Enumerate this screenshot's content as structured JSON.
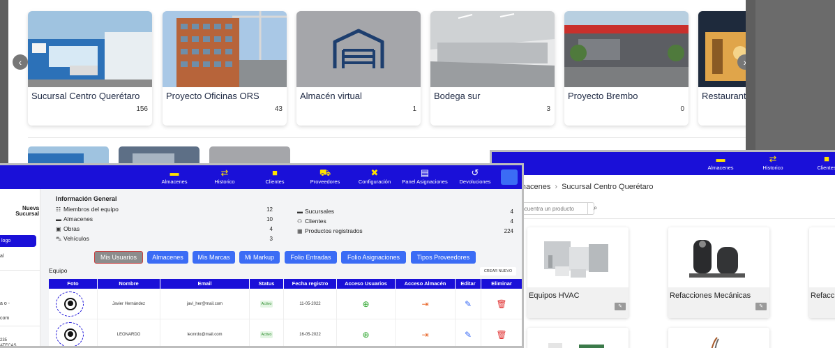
{
  "warehouses": [
    {
      "name": "Sucursal Centro Querétaro",
      "count": "156"
    },
    {
      "name": "Proyecto Oficinas ORS",
      "count": "43"
    },
    {
      "name": "Almacén virtual",
      "count": "1"
    },
    {
      "name": "Bodega sur",
      "count": "3"
    },
    {
      "name": "Proyecto Brembo",
      "count": "0"
    },
    {
      "name": "Restaurant",
      "count": ""
    }
  ],
  "carousel_arrows": {
    "prev": "‹",
    "next": "›"
  },
  "catalog_window": {
    "nav": [
      {
        "icon": "warehouse-icon",
        "label": "Almacenes"
      },
      {
        "icon": "swap-icon",
        "label": "Historico"
      },
      {
        "icon": "user-icon",
        "label": "Clientes"
      }
    ],
    "breadcrumb": {
      "root": "Almacenes",
      "current": "Sucursal Centro Querétaro"
    },
    "search": {
      "placeholder": "Encuentra un producto"
    },
    "categories": [
      {
        "name": "Equipos HVAC"
      },
      {
        "name": "Refacciones Mecánicas"
      },
      {
        "name": "Refacciones"
      }
    ]
  },
  "admin_window": {
    "nav": [
      {
        "icon": "warehouse-icon",
        "label": "Almacenes"
      },
      {
        "icon": "swap-icon",
        "label": "Historico"
      },
      {
        "icon": "user-icon",
        "label": "Clientes"
      },
      {
        "icon": "truck-icon",
        "label": "Proveedores"
      },
      {
        "icon": "tools-icon",
        "label": "Configuración"
      },
      {
        "icon": "panel-icon",
        "label": "Panel Asignaciones"
      },
      {
        "icon": "undo-icon",
        "label": "Devoluciones"
      }
    ],
    "sidebar": {
      "title": "Nueva Sucursal",
      "active_item": "logo",
      "items": [
        "al",
        "a o -",
        "com",
        "235",
        "ATECAS"
      ]
    },
    "info": {
      "title": "Información General",
      "left": [
        {
          "label": "Miembros del equipo",
          "value": "12"
        },
        {
          "label": "Almacenes",
          "value": "10"
        },
        {
          "label": "Obras",
          "value": "4"
        },
        {
          "label": "Vehículos",
          "value": "3"
        }
      ],
      "right": [
        {
          "label": "Sucursales",
          "value": "4"
        },
        {
          "label": "Clientes",
          "value": "4"
        },
        {
          "label": "Productos registrados",
          "value": "224"
        }
      ]
    },
    "tabs": [
      "Mis Usuarios",
      "Almacenes",
      "Mis Marcas",
      "Mi Markup",
      "Folio Entradas",
      "Folio Asignaciones",
      "Tipos Proveedores"
    ],
    "team": {
      "title": "Equipo",
      "create_label": "CREAR NUEVO",
      "columns": [
        "Foto",
        "Nombre",
        "Email",
        "Status",
        "Fecha registro",
        "Acceso Usuarios",
        "Acceso Almacén",
        "Editar",
        "Eliminar"
      ],
      "rows": [
        {
          "name": "Javier Hernández",
          "email": "javi_her@mail.com",
          "status": "Activo",
          "date": "11-05-2022"
        },
        {
          "name": "LEONARDO",
          "email": "leonrdo@mail.com",
          "status": "Activo",
          "date": "16-05-2022"
        }
      ]
    }
  }
}
